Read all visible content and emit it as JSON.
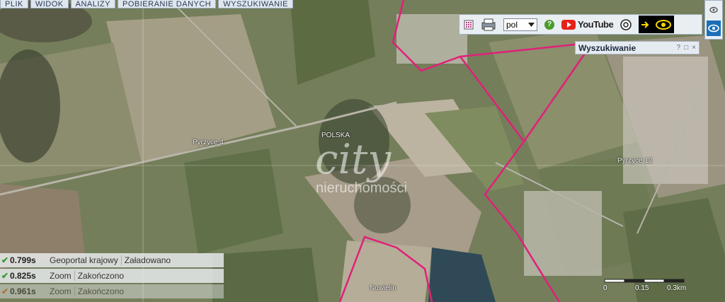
{
  "menu": [
    "Plik",
    "Widok",
    "Analizy",
    "Pobieranie danych",
    "Wyszukiwanie"
  ],
  "toolbar": {
    "language": "pol",
    "youtube_label": "YouTube",
    "help": "?"
  },
  "search_panel": {
    "title": "Wyszukiwanie",
    "help": "?",
    "restore": "□",
    "close": "×"
  },
  "map_labels": {
    "polska": "POLSKA",
    "pyrzyce4": "Pyrzyce 4",
    "pyrzyce12": "Pyrzyce 12",
    "nowielin": "Nowielin"
  },
  "watermark": {
    "line1": "city",
    "line2": "nieruchomości"
  },
  "status": [
    {
      "time": "0.799s",
      "name": "Geoportal krajowy",
      "state": "Załadowano"
    },
    {
      "time": "0.825s",
      "name": "Zoom",
      "state": "Zakończono"
    },
    {
      "time": "0.961s",
      "name": "Zoom",
      "state": "Zakończono"
    }
  ],
  "scale": {
    "labels": [
      "0",
      "0.15",
      "0.3km"
    ]
  },
  "colors": {
    "boundary": "#e0207a",
    "toolbar_bg": "#e9eef3"
  }
}
